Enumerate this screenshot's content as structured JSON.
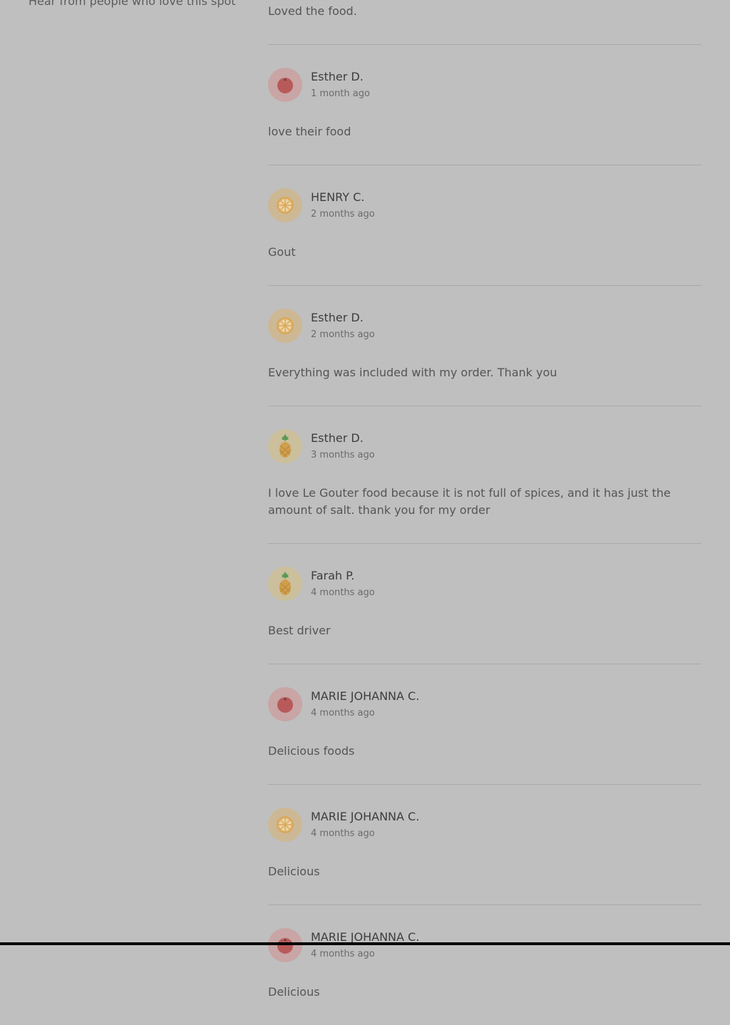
{
  "page": {
    "subtitle": "Hear from people who love this spot"
  },
  "first_review": {
    "text": "Loved the food."
  },
  "reviews": [
    {
      "author": "Esther D.",
      "time": "1 month ago",
      "text": "love their food",
      "avatar": "tomato-icon"
    },
    {
      "author": "HENRY C.",
      "time": "2 months ago",
      "text": "Gout",
      "avatar": "orange-slice-icon"
    },
    {
      "author": "Esther D.",
      "time": "2 months ago",
      "text": "Everything was included with my order. Thank you",
      "avatar": "orange-slice-icon"
    },
    {
      "author": "Esther D.",
      "time": "3 months ago",
      "text": "I love Le Gouter food because it is not full of spices, and it has just the amount of salt. thank you for my order",
      "avatar": "pineapple-icon"
    },
    {
      "author": "Farah P.",
      "time": "4 months ago",
      "text": "Best driver",
      "avatar": "pineapple-icon"
    },
    {
      "author": "MARIE JOHANNA C.",
      "time": "4 months ago",
      "text": "Delicious foods",
      "avatar": "tomato-icon"
    },
    {
      "author": "MARIE JOHANNA C.",
      "time": "4 months ago",
      "text": "Delicious",
      "avatar": "orange-slice-icon"
    },
    {
      "author": "MARIE JOHANNA C.",
      "time": "4 months ago",
      "text": "Delicious",
      "avatar": "tomato-icon"
    }
  ],
  "colors": {
    "background": "#bfbfbf",
    "tomato": "#b85a5a",
    "orange": "#d9a85c",
    "pineapple": "#cf9f4e",
    "leaf": "#5a9a55"
  }
}
